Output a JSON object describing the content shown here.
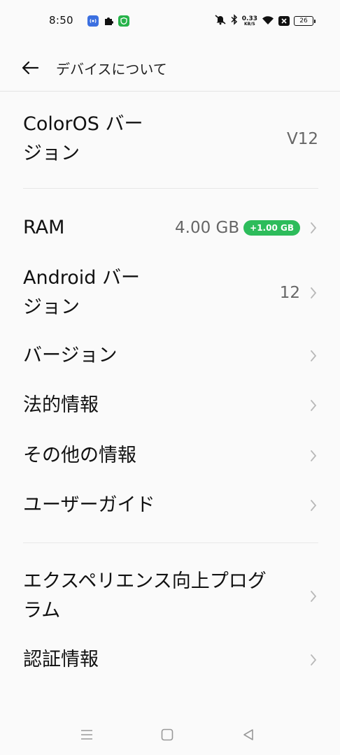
{
  "status_bar": {
    "time": "8:50",
    "net_speed_value": "0.33",
    "net_speed_unit": "KB/S",
    "battery": "26"
  },
  "app_bar": {
    "title": "デバイスについて"
  },
  "items": {
    "coloros": {
      "label_line1": "ColorOS バー",
      "label_line2": "ジョン",
      "value": "V12"
    },
    "ram": {
      "label": "RAM",
      "value": "4.00 GB",
      "badge": "+1.00 GB"
    },
    "android": {
      "label_line1": "Android バー",
      "label_line2": "ジョン",
      "value": "12"
    },
    "version": {
      "label": "バージョン"
    },
    "legal": {
      "label": "法的情報"
    },
    "other": {
      "label": "その他の情報"
    },
    "guide": {
      "label": "ユーザーガイド"
    },
    "experience": {
      "label_line1": "エクスペリエンス向上プログ",
      "label_line2": "ラム"
    },
    "cert": {
      "label": "認証情報"
    }
  },
  "colors": {
    "accent_green": "#2dbc5b",
    "background": "#fafafa"
  }
}
